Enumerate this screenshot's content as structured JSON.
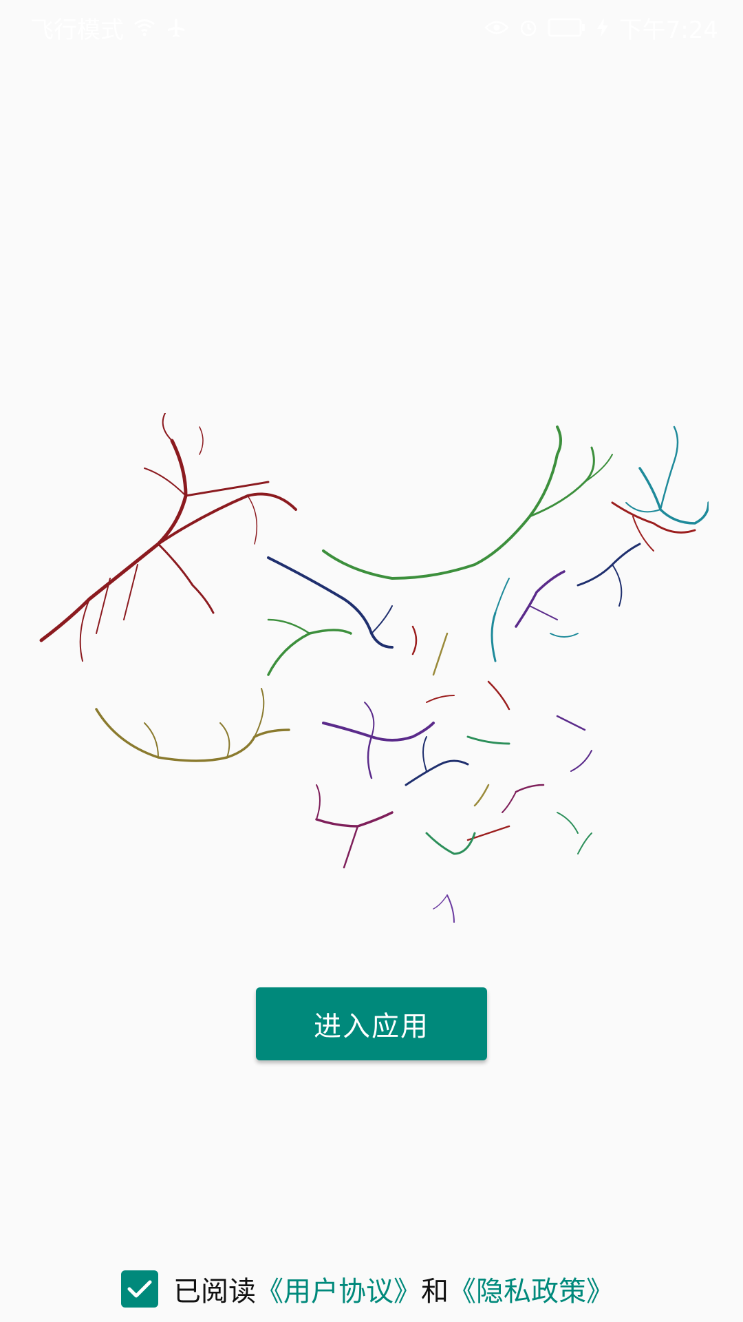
{
  "status_bar": {
    "left_text": "飞行模式",
    "time": "下午7:24",
    "icons_left": [
      "wifi-icon",
      "airplane-icon"
    ],
    "icons_right": [
      "eye-icon",
      "alarm-icon",
      "battery-icon",
      "charging-icon"
    ]
  },
  "colors": {
    "accent": "#00897b",
    "background": "#fafafa"
  },
  "enter_button": {
    "label": "进入应用"
  },
  "agreement": {
    "checked": true,
    "prefix": "已阅读",
    "user_agreement": "《用户协议》",
    "conjunction": "和",
    "privacy_policy": "《隐私政策》"
  }
}
